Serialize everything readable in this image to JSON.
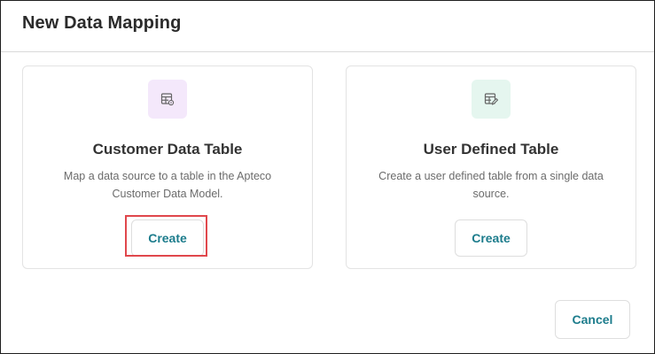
{
  "dialog": {
    "title": "New Data Mapping"
  },
  "cards": [
    {
      "title": "Customer Data Table",
      "description": "Map a data source to a table in the Apteco Customer Data Model.",
      "button_label": "Create",
      "icon": "table-link-icon",
      "icon_bg_color": "#f4e8fb",
      "highlighted": true
    },
    {
      "title": "User Defined Table",
      "description": "Create a user defined table from a single data source.",
      "button_label": "Create",
      "icon": "table-edit-icon",
      "icon_bg_color": "#e5f6ef",
      "highlighted": false
    }
  ],
  "footer": {
    "cancel_label": "Cancel"
  },
  "colors": {
    "accent": "#1c7c8c",
    "highlight": "#e0474c"
  }
}
